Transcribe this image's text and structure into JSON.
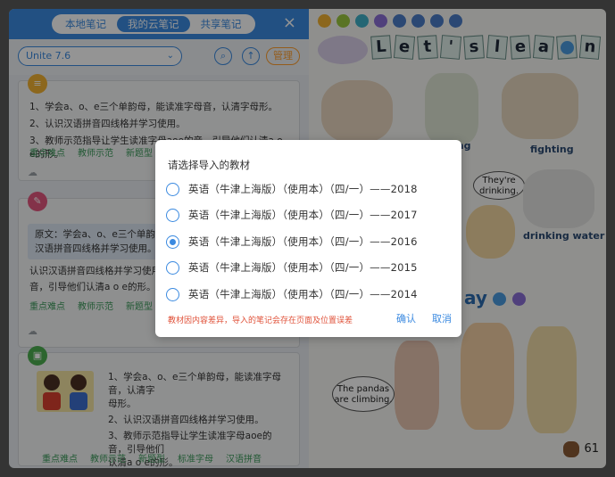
{
  "notes_panel": {
    "tabs": [
      "本地笔记",
      "我的云笔记",
      "共享笔记"
    ],
    "active_tab": 1,
    "close_label": "×",
    "unit_select": "Unite 7.6",
    "manage_label": "管理",
    "tags": [
      "重点难点",
      "教师示范",
      "新题型"
    ],
    "tags_long": [
      "重点难点",
      "教师示范",
      "新题型",
      "标准字母",
      "汉语拼音"
    ],
    "card1": {
      "lines": [
        "1、学会a、o、e三个单韵母，能读准字母音，认清字母形。",
        "2、认识汉语拼音四线格并学习使用。",
        "3、教师示范指导让学生读准字母aoe的音，引导他们认清a o e的形。"
      ]
    },
    "card2": {
      "quote": [
        "原文：学会a、o、e三个单韵母，",
        "汉语拼音四线格并学习使用。"
      ],
      "lines": [
        "认识汉语拼音四线格并学习使用。",
        "音，引导他们认清a o e的形。"
      ]
    },
    "card3": {
      "lines": [
        "1、学会a、o、e三个单韵母，能读准字母音，认清字",
        "母形。",
        "2、认识汉语拼音四线格并学习使用。",
        "3、教师示范指导让学生读准字母aoe的音，引导他们",
        "认清a o e的形。"
      ]
    }
  },
  "book": {
    "title_letters": [
      "L",
      "e",
      "t",
      "'",
      "s",
      "l",
      "e",
      "a",
      "r",
      "n"
    ],
    "labels": {
      "fighting": "fighting",
      "drinking_water": "drinking water",
      "ing": "ing",
      "ay": "ay"
    },
    "bubbles": {
      "drinking": "They're drinking.",
      "pandas": "The pandas are climbing."
    },
    "page_number": "61"
  },
  "dialog": {
    "title": "请选择导入的教材",
    "options": [
      {
        "label": "英语（牛津上海版）（使用本）（四/一）——2018",
        "checked": false
      },
      {
        "label": "英语（牛津上海版）（使用本）（四/一）——2017",
        "checked": false
      },
      {
        "label": "英语（牛津上海版）（使用本）（四/一）——2016",
        "checked": true
      },
      {
        "label": "英语（牛津上海版）（使用本）（四/一）——2015",
        "checked": false
      },
      {
        "label": "英语（牛津上海版）（使用本）（四/一）——2014",
        "checked": false
      }
    ],
    "warning": "教材因内容差异，导入的笔记会存在页面及位置误差",
    "confirm_label": "确认",
    "cancel_label": "取消"
  },
  "colors": {
    "accent": "#3b8ae0",
    "warning": "#e0523a",
    "tag_green": "#3b9a5a",
    "manage_orange": "#ff9f2e"
  }
}
